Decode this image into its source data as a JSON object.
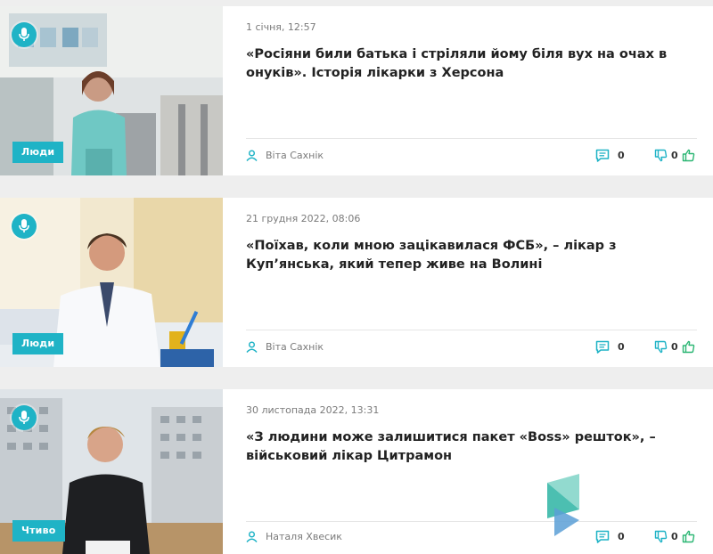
{
  "colors": {
    "accent": "#1fb3c6",
    "like": "#2bb673",
    "text": "#222222",
    "muted": "#7a7a7a"
  },
  "icons": {
    "audio": "microphone-icon",
    "author": "user-icon",
    "comments": "comment-icon",
    "dislike": "thumbs-down-icon",
    "like": "thumbs-up-icon",
    "logo": "brand-logo-icon"
  },
  "articles": [
    {
      "date": "1 січня, 12:57",
      "title": "«Росіяни били батька і стріляли йому біля вух на очах в онуків». Історія лікарки з Херсона",
      "category": "Люди",
      "author": "Віта Сахнік",
      "comments": "0",
      "votes": "0"
    },
    {
      "date": "21 грудня 2022, 08:06",
      "title": "«Поїхав, коли мною зацікавилася ФСБ», – лікар з Куп’янська, який тепер живе на Волині",
      "category": "Люди",
      "author": "Віта Сахнік",
      "comments": "0",
      "votes": "0"
    },
    {
      "date": "30 листопада 2022, 13:31",
      "title": "«З людини може залишитися пакет «Boss» решток», – військовий лікар Цитрамон",
      "category": "Чтиво",
      "author": "Наталя Хвесик",
      "comments": "0",
      "votes": "0"
    }
  ]
}
